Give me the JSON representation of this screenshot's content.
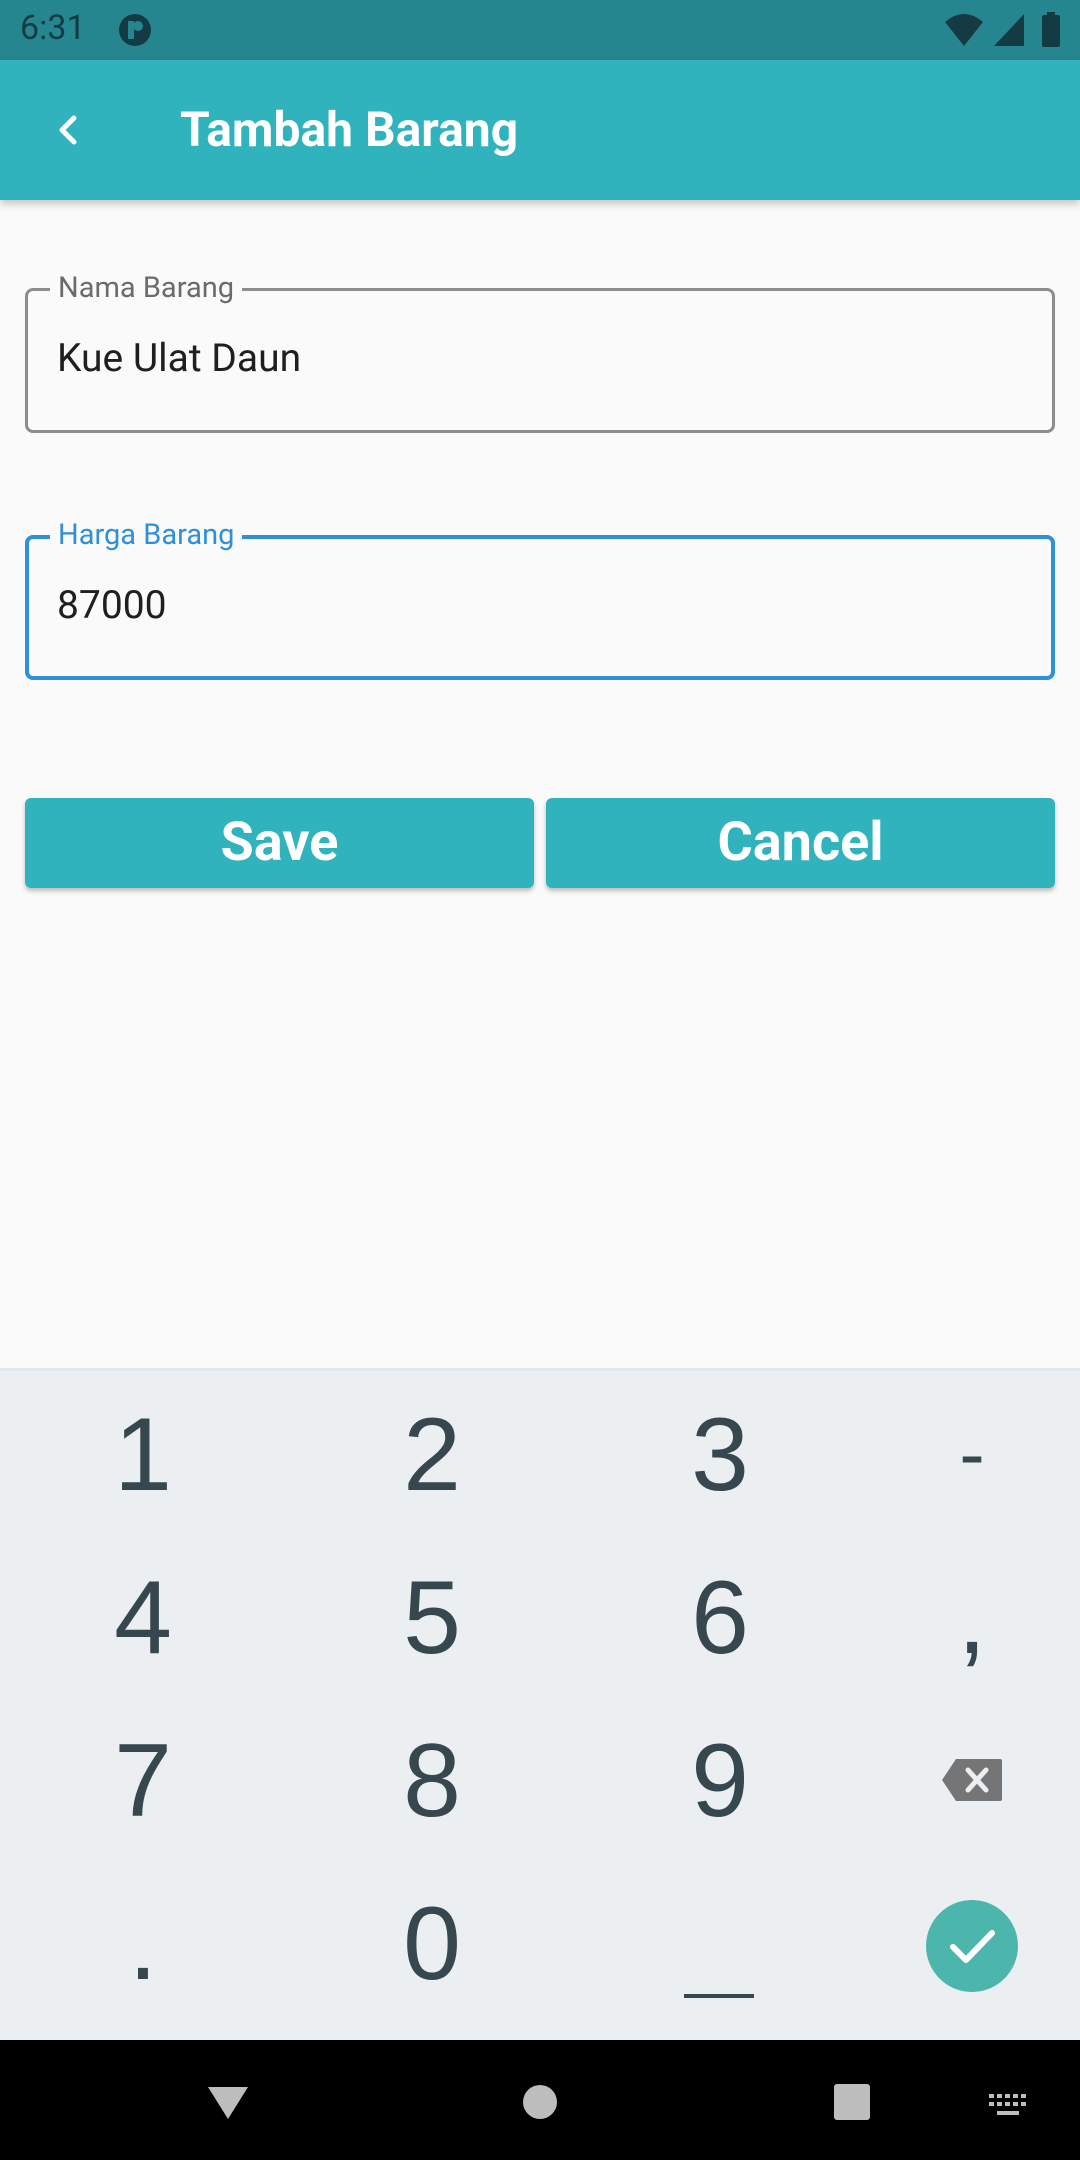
{
  "status_bar": {
    "time": "6:31"
  },
  "app_bar": {
    "title": "Tambah Barang"
  },
  "form": {
    "nama_barang": {
      "label": "Nama Barang",
      "value": "Kue Ulat Daun"
    },
    "harga_barang": {
      "label": "Harga Barang",
      "value": "87000"
    }
  },
  "buttons": {
    "save": "Save",
    "cancel": "Cancel"
  },
  "keyboard": {
    "keys": [
      "1",
      "2",
      "3",
      "-",
      "4",
      "5",
      "6",
      ",",
      "7",
      "8",
      "9",
      ".",
      "0"
    ]
  },
  "colors": {
    "primary": "#30b3bd",
    "status_bar": "#258690",
    "focus": "#2f8fd9",
    "keyboard_bg": "#eceff1",
    "key_text": "#37474f",
    "enter_key": "#4db6ac"
  },
  "icons": {
    "back": "chevron-left-icon",
    "backspace": "backspace-icon",
    "enter": "check-icon",
    "nav_back": "triangle-back-icon",
    "nav_home": "circle-home-icon",
    "nav_recents": "square-recents-icon",
    "nav_keyboard": "keyboard-icon"
  }
}
